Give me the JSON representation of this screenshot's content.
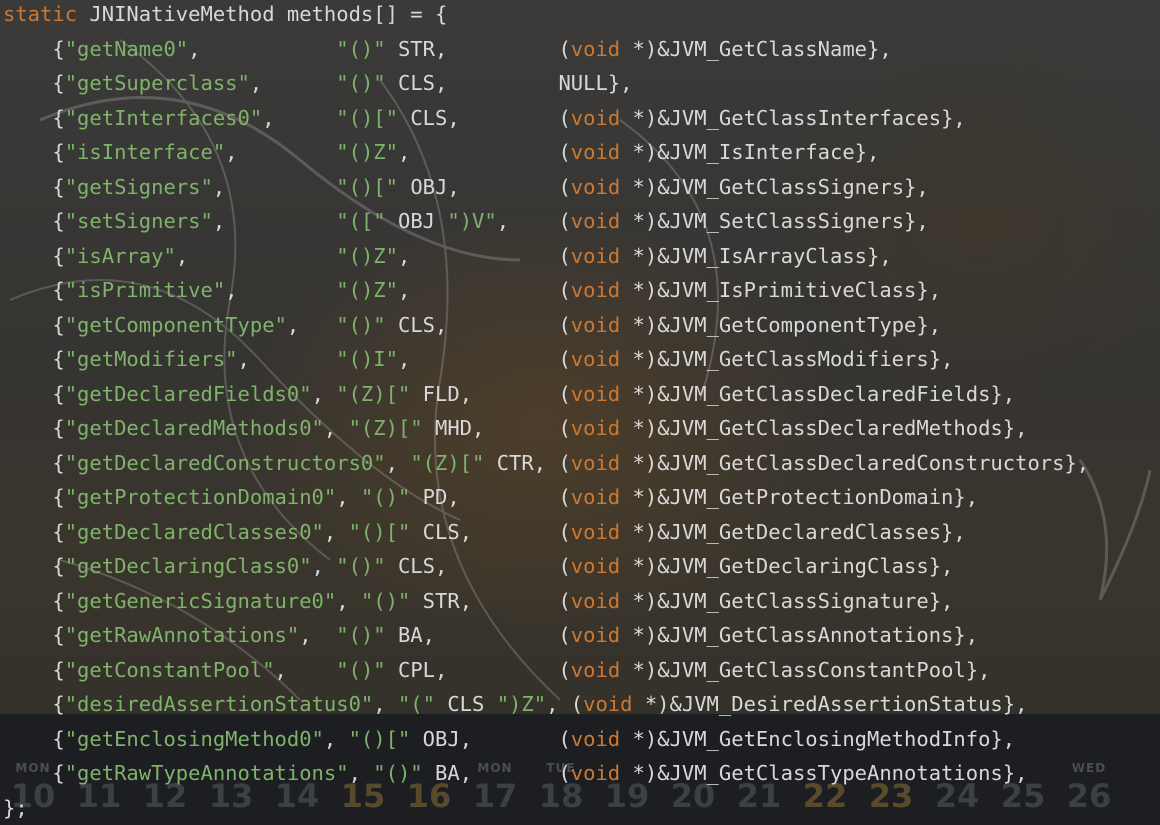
{
  "code": {
    "header_keyword": "static",
    "header_rest": " JNINativeMethod methods[] = {",
    "footer": "};",
    "methods": [
      {
        "name": "\"getName0\"",
        "sig": "\"()\"",
        "type": "STR",
        "fn": "&JVM_GetClassName},"
      },
      {
        "name": "\"getSuperclass\"",
        "sig": "\"()\"",
        "type": "CLS",
        "fn": "NULL},"
      },
      {
        "name": "\"getInterfaces0\"",
        "sig": "\"()[\"",
        "type": "CLS",
        "fn": "&JVM_GetClassInterfaces},"
      },
      {
        "name": "\"isInterface\"",
        "sig": "\"()Z\"",
        "type": "",
        "fn": "&JVM_IsInterface},"
      },
      {
        "name": "\"getSigners\"",
        "sig": "\"()[\"",
        "type": "OBJ",
        "fn": "&JVM_GetClassSigners},"
      },
      {
        "name": "\"setSigners\"",
        "sig": "\"([\"",
        "type": "OBJ",
        "sig2": "\")V\"",
        "fn": "&JVM_SetClassSigners},"
      },
      {
        "name": "\"isArray\"",
        "sig": "\"()Z\"",
        "type": "",
        "fn": "&JVM_IsArrayClass},"
      },
      {
        "name": "\"isPrimitive\"",
        "sig": "\"()Z\"",
        "type": "",
        "fn": "&JVM_IsPrimitiveClass},"
      },
      {
        "name": "\"getComponentType\"",
        "sig": "\"()\"",
        "type": "CLS",
        "fn": "&JVM_GetComponentType},"
      },
      {
        "name": "\"getModifiers\"",
        "sig": "\"()I\"",
        "type": "",
        "fn": "&JVM_GetClassModifiers},"
      },
      {
        "name": "\"getDeclaredFields0\"",
        "sig": "\"(Z)[\"",
        "type": "FLD",
        "fn": "&JVM_GetClassDeclaredFields},"
      },
      {
        "name": "\"getDeclaredMethods0\"",
        "sig": "\"(Z)[\"",
        "type": "MHD",
        "fn": "&JVM_GetClassDeclaredMethods},"
      },
      {
        "name": "\"getDeclaredConstructors0\"",
        "sig": "\"(Z)[\"",
        "type": "CTR",
        "fn": "&JVM_GetClassDeclaredConstructors},"
      },
      {
        "name": "\"getProtectionDomain0\"",
        "sig": "\"()\"",
        "type": "PD",
        "fn": "&JVM_GetProtectionDomain},"
      },
      {
        "name": "\"getDeclaredClasses0\"",
        "sig": "\"()[\"",
        "type": "CLS",
        "fn": "&JVM_GetDeclaredClasses},"
      },
      {
        "name": "\"getDeclaringClass0\"",
        "sig": "\"()\"",
        "type": "CLS",
        "fn": "&JVM_GetDeclaringClass},"
      },
      {
        "name": "\"getGenericSignature0\"",
        "sig": "\"()\"",
        "type": "STR",
        "fn": "&JVM_GetClassSignature},"
      },
      {
        "name": "\"getRawAnnotations\"",
        "sig": "\"()\"",
        "type": "BA",
        "fn": "&JVM_GetClassAnnotations},"
      },
      {
        "name": "\"getConstantPool\"",
        "sig": "\"()\"",
        "type": "CPL",
        "fn": "&JVM_GetClassConstantPool},"
      },
      {
        "name": "\"desiredAssertionStatus0\"",
        "sig": "\"(\"",
        "type": "CLS",
        "sig2": "\")Z\"",
        "fn": "&JVM_DesiredAssertionStatus},"
      },
      {
        "name": "\"getEnclosingMethod0\"",
        "sig": "\"()[\"",
        "type": "OBJ",
        "fn": "&JVM_GetEnclosingMethodInfo},"
      },
      {
        "name": "\"getRawTypeAnnotations\"",
        "sig": "\"()\"",
        "type": "BA",
        "fn": "&JVM_GetClassTypeAnnotations},"
      }
    ],
    "cast_keyword": "void",
    "cast_rest": " *)"
  },
  "calendar": {
    "days": [
      {
        "weekday": "MON",
        "date": "10"
      },
      {
        "weekday": "",
        "date": "11"
      },
      {
        "weekday": "",
        "date": "12"
      },
      {
        "weekday": "",
        "date": "13"
      },
      {
        "weekday": "",
        "date": "14"
      },
      {
        "weekday": "",
        "date": "15"
      },
      {
        "weekday": "",
        "date": "16"
      },
      {
        "weekday": "MON",
        "date": "17"
      },
      {
        "weekday": "TUE",
        "date": "18"
      },
      {
        "weekday": "",
        "date": "19"
      },
      {
        "weekday": "",
        "date": "20"
      },
      {
        "weekday": "",
        "date": "21"
      },
      {
        "weekday": "",
        "date": "22"
      },
      {
        "weekday": "",
        "date": "23"
      },
      {
        "weekday": "",
        "date": "24"
      },
      {
        "weekday": "",
        "date": "25"
      },
      {
        "weekday": "WED",
        "date": "26"
      }
    ]
  },
  "colors": {
    "keyword": "#cc7832",
    "string": "#7fb36b",
    "text": "#d8d8d8"
  }
}
